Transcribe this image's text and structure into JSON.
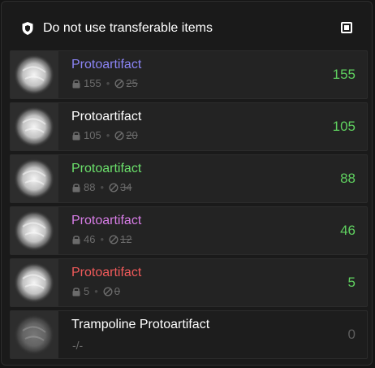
{
  "header": {
    "title": "Do not use transferable items",
    "checkbox_checked": true
  },
  "items": [
    {
      "name": "Protoartifact",
      "name_color": "#8b84f5",
      "locked": "155",
      "cap": "25",
      "count": "155"
    },
    {
      "name": "Protoartifact",
      "name_color": "#ffffff",
      "locked": "105",
      "cap": "20",
      "count": "105"
    },
    {
      "name": "Protoartifact",
      "name_color": "#6be06b",
      "locked": "88",
      "cap": "34",
      "count": "88"
    },
    {
      "name": "Protoartifact",
      "name_color": "#d77de6",
      "locked": "46",
      "cap": "12",
      "count": "46"
    },
    {
      "name": "Protoartifact",
      "name_color": "#f05a5a",
      "locked": "5",
      "cap": "0",
      "count": "5"
    },
    {
      "name": "Trampoline Protoartifact",
      "name_color": "#ffffff",
      "placeholder": "-/-",
      "count": "0"
    }
  ],
  "colors": {
    "count_green": "#5fd05f",
    "count_zero": "#5d5d5d",
    "meta_grey": "#6b6b6b"
  },
  "icons": {
    "header": "shield-icon",
    "checkbox": "checkbox-icon",
    "lock": "lock-icon",
    "cap": "shield-strike-icon",
    "item": "protoartifact-orb-icon"
  }
}
